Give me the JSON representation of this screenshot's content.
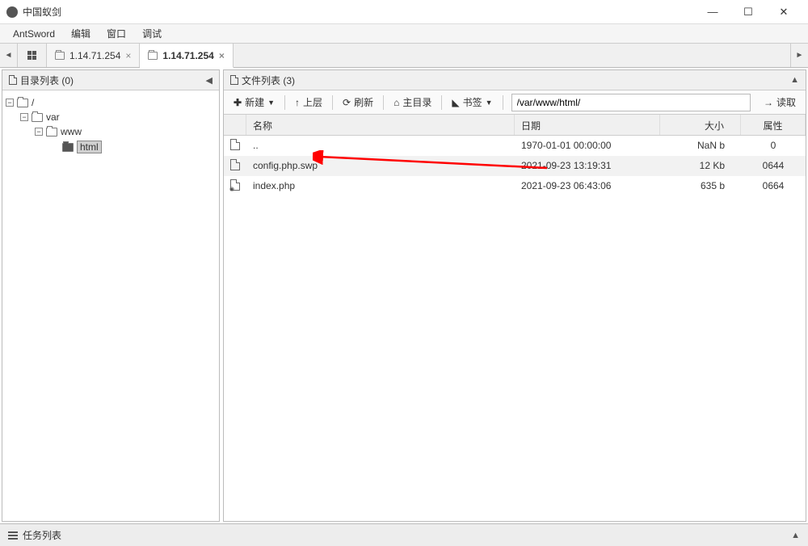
{
  "window": {
    "title": "中国蚁剑"
  },
  "menubar": {
    "antsword": "AntSword",
    "edit": "编辑",
    "window": "窗口",
    "debug": "调试"
  },
  "tabs": {
    "tab1": "1.14.71.254",
    "tab2": "1.14.71.254"
  },
  "sidebar": {
    "title": "目录列表 (0)",
    "tree": {
      "root": "/",
      "var": "var",
      "www": "www",
      "html": "html"
    }
  },
  "filepanel": {
    "title": "文件列表 (3)"
  },
  "toolbar": {
    "new": "新建",
    "up": "上层",
    "refresh": "刷新",
    "home": "主目录",
    "bookmark": "书签",
    "path": "/var/www/html/",
    "read": "读取"
  },
  "columns": {
    "name": "名称",
    "date": "日期",
    "size": "大小",
    "attr": "属性"
  },
  "files": [
    {
      "name": "..",
      "date": "1970-01-01 00:00:00",
      "size": "NaN b",
      "attr": "0",
      "type": "file"
    },
    {
      "name": "config.php.swp",
      "date": "2021-09-23 13:19:31",
      "size": "12 Kb",
      "attr": "0644",
      "type": "file",
      "highlighted": true
    },
    {
      "name": "index.php",
      "date": "2021-09-23 06:43:06",
      "size": "635 b",
      "attr": "0664",
      "type": "php"
    }
  ],
  "taskbar": {
    "title": "任务列表"
  }
}
